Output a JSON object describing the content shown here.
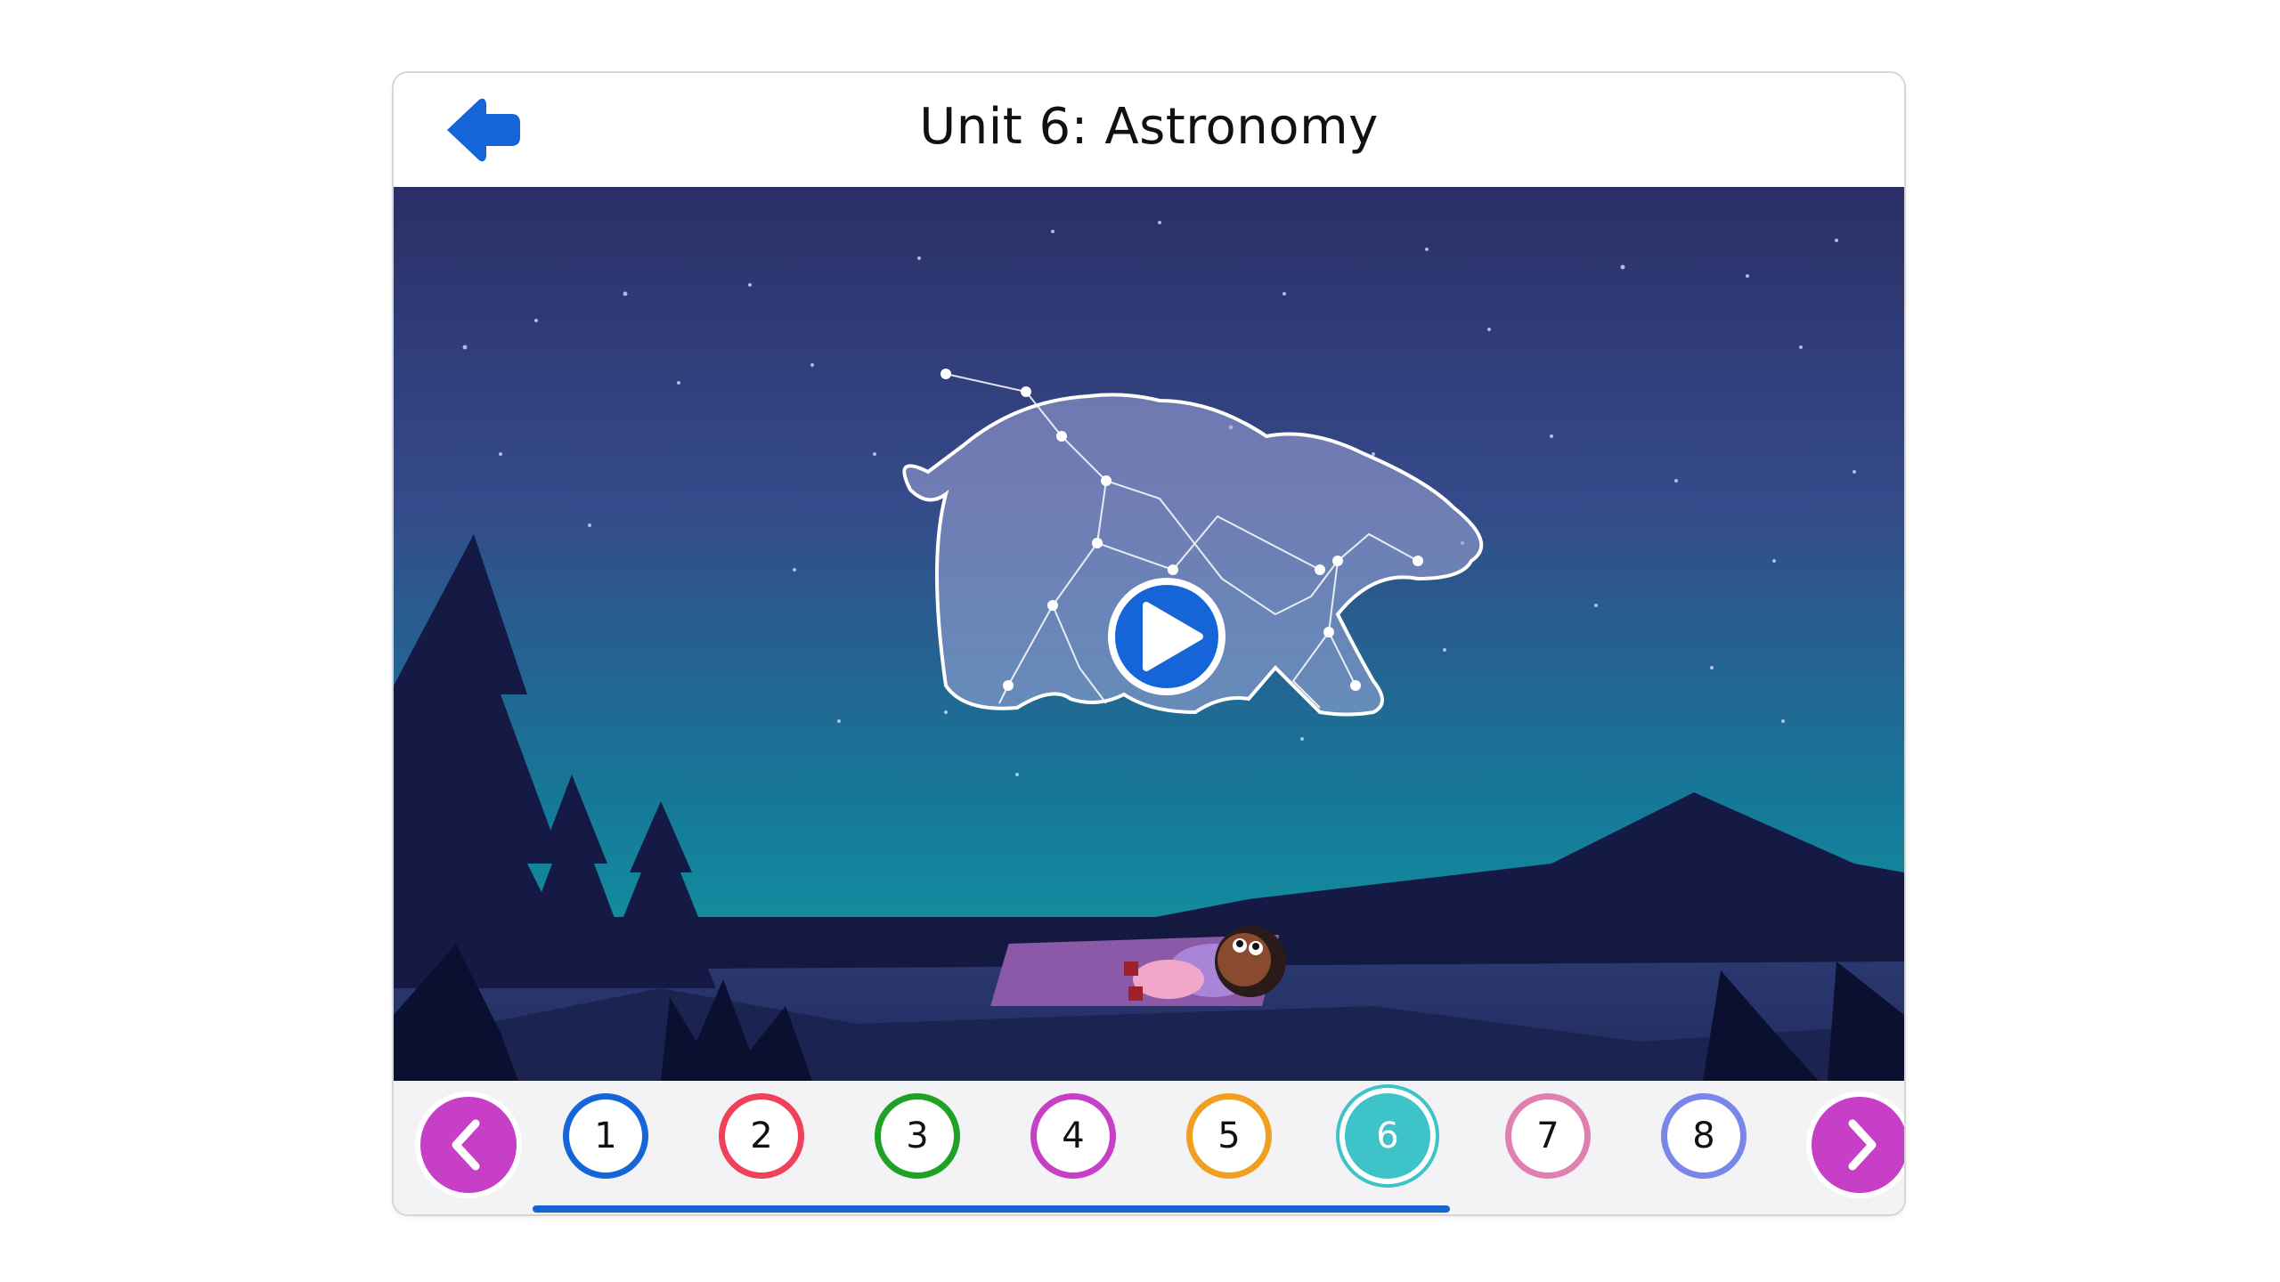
{
  "header": {
    "title": "Unit 6: Astronomy",
    "back_icon": "back-arrow-icon"
  },
  "video": {
    "play_icon": "play-icon"
  },
  "nav": {
    "prev_icon": "chevron-left-icon",
    "next_icon": "chevron-right-icon",
    "lessons": [
      {
        "label": "1",
        "color": "#1565d8"
      },
      {
        "label": "2",
        "color": "#f0405a"
      },
      {
        "label": "3",
        "color": "#1fa125"
      },
      {
        "label": "4",
        "color": "#c73ec7"
      },
      {
        "label": "5",
        "color": "#f0a020"
      },
      {
        "label": "6",
        "color": "#3ec3c8",
        "active": true
      },
      {
        "label": "7",
        "color": "#e080b0"
      },
      {
        "label": "8",
        "color": "#7a86e8"
      }
    ],
    "progress": 0.75
  },
  "colors": {
    "accent": "#1565d8",
    "nav_arrow": "#c73ec7"
  }
}
